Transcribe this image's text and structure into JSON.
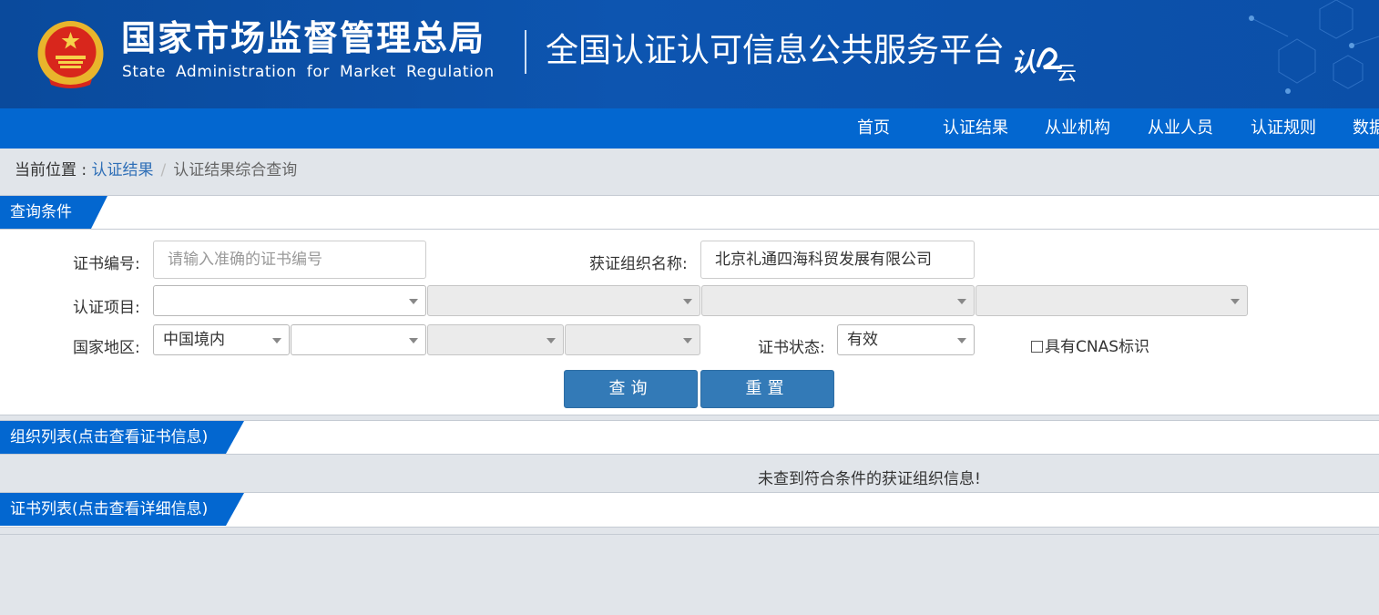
{
  "header": {
    "org_cn": "国家市场监督管理总局",
    "org_en": "State Administration for Market Regulation",
    "platform": "全国认证认可信息公共服务平台",
    "logo_text_a": "认",
    "logo_text_b": "云"
  },
  "nav": {
    "items": [
      {
        "label": "首页"
      },
      {
        "label": "认证结果"
      },
      {
        "label": "从业机构"
      },
      {
        "label": "从业人员"
      },
      {
        "label": "认证规则"
      },
      {
        "label": "数据"
      }
    ]
  },
  "breadcrumb": {
    "prefix": "当前位置 : ",
    "link": "认证结果",
    "separator": "/",
    "current": "认证结果综合查询"
  },
  "query_panel": {
    "title": "查询条件",
    "cert_no_label": "证书编号:",
    "cert_no_placeholder": "请输入准确的证书编号",
    "org_name_label": "获证组织名称:",
    "org_name_value": "北京礼通四海科贸发展有限公司",
    "project_label": "认证项目:",
    "region_label": "国家地区:",
    "region_value": "中国境内",
    "status_label": "证书状态:",
    "status_value": "有效",
    "cnas_label": "具有CNAS标识",
    "search_button": "查询",
    "reset_button": "重置"
  },
  "org_list": {
    "title": "组织列表(点击查看证书信息)",
    "empty_message": "未查到符合条件的获证组织信息!"
  },
  "cert_list": {
    "title": "证书列表(点击查看详细信息)"
  },
  "colors": {
    "header_bg": "#0b4fa8",
    "nav_bg": "#0367d0",
    "tab_bg": "#0367d0",
    "button_bg": "#337ab7",
    "page_bg": "#e1e5ea"
  }
}
